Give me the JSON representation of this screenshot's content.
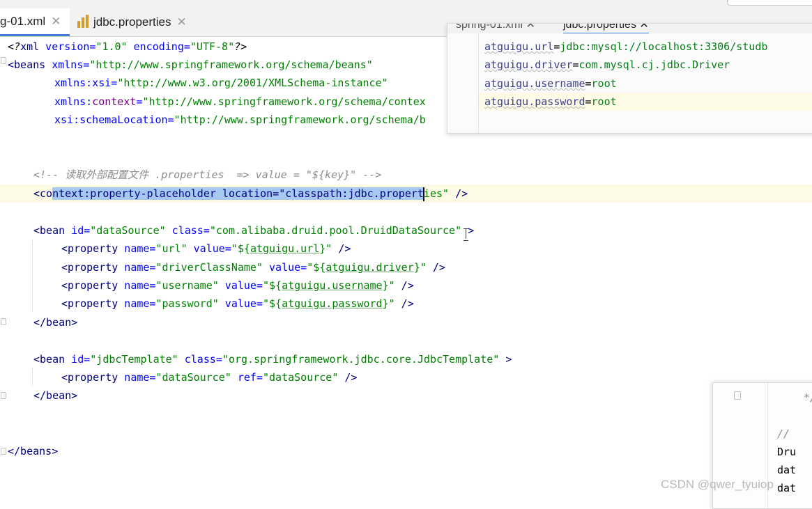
{
  "tabs": [
    {
      "label": "g-01.xml",
      "active": true,
      "close": "✕"
    },
    {
      "label": "jdbc.properties",
      "active": false,
      "close": "✕"
    }
  ],
  "code": {
    "l1": {
      "a": "<?",
      "b": "xml",
      "c": " version=",
      "d": "\"1.0\"",
      "e": " encoding=",
      "f": "\"UTF-8\"",
      "g": "?>"
    },
    "l2": {
      "a": "<beans",
      "b": " xmlns=",
      "c": "\"http://www.springframework.org/schema/beans\""
    },
    "l3": {
      "a": "xmlns:xsi=",
      "b": "\"http://www.w3.org/2001/XMLSchema-instance\""
    },
    "l4": {
      "a": "xmlns:",
      "b": "context",
      "c": "=",
      "d": "\"http://www.springframework.org/schema/contex"
    },
    "l5": {
      "a": "xsi:schemaLocation=",
      "b": "\"http://www.springframework.org/schema/b"
    },
    "comment": "<!-- 读取外部配置文件 .properties  => value = \"${key}\" -->",
    "ph": {
      "a": "<co",
      "b": "ntext:property-placeholder location=\"classpath:jdbc.propert",
      "c": "ies\"",
      "d": " />"
    },
    "bean1": {
      "a": "<bean",
      "b": " id=",
      "c": "\"dataSource\"",
      "d": " class=",
      "e": "\"com.alibaba.druid.pool.DruidDataSource\"",
      "f": " >"
    },
    "p1": {
      "a": "<property",
      "b": " name=",
      "c": "\"url\"",
      "d": " value=",
      "e": "\"${",
      "f": "atguigu.url",
      "g": "}\"",
      "h": " />"
    },
    "p2": {
      "a": "<property",
      "b": " name=",
      "c": "\"driverClassName\"",
      "d": " value=",
      "e": "\"${",
      "f": "atguigu.driver",
      "g": "}\"",
      "h": " />"
    },
    "p3": {
      "a": "<property",
      "b": " name=",
      "c": "\"username\"",
      "d": " value=",
      "e": "\"${",
      "f": "atguigu.username",
      "g": "}\"",
      "h": " />"
    },
    "p4": {
      "a": "<property",
      "b": " name=",
      "c": "\"password\"",
      "d": " value=",
      "e": "\"${",
      "f": "atguigu.password",
      "g": "}\"",
      "h": " />"
    },
    "bean_end": "</bean>",
    "bean2": {
      "a": "<bean",
      "b": " id=",
      "c": "\"jdbcTemplate\"",
      "d": " class=",
      "e": "\"org.springframework.jdbc.core.JdbcTemplate\"",
      "f": " >"
    },
    "p5": {
      "a": "<property",
      "b": " name=",
      "c": "\"dataSource\"",
      "d": " ref=",
      "e": "\"dataSource\"",
      "f": " />"
    },
    "beans_end": "</beans>"
  },
  "panel": {
    "tabs": [
      "spring-01.xml ✕",
      "jdbc.properties ✕"
    ],
    "lines": [
      {
        "key": "atguigu.url",
        "eq": "=",
        "value": "jdbc:mysql://localhost:3306/studb"
      },
      {
        "key": "atguigu.driver",
        "eq": "=",
        "value": "com.mysql.cj.jdbc.Driver"
      },
      {
        "key": "atguigu.username",
        "eq": "=",
        "value": "root"
      },
      {
        "key": "atguigu.password",
        "eq": "=",
        "value": "root"
      }
    ]
  },
  "second_window": {
    "lines": [
      "*/",
      "//",
      "Dru",
      "dat",
      "dat"
    ]
  },
  "watermark": "CSDN @qwer_tyuiop"
}
